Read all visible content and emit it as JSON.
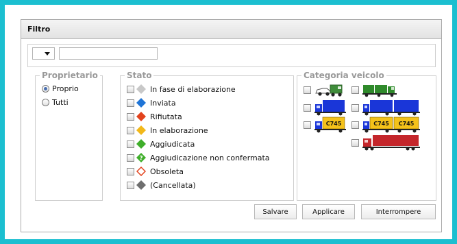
{
  "panel": {
    "title": "Filtro"
  },
  "search": {
    "dropdown_value": "",
    "text_value": ""
  },
  "owner": {
    "legend": "Proprietario",
    "options": [
      {
        "label": "Proprio",
        "checked": true
      },
      {
        "label": "Tutti",
        "checked": false
      }
    ]
  },
  "stato": {
    "legend": "Stato",
    "items": [
      {
        "label": "In fase di elaborazione",
        "icon": "gray-diamond-icon",
        "color": "#c8c8c8"
      },
      {
        "label": "Inviata",
        "icon": "blue-diamond-icon",
        "color": "#1f74d6"
      },
      {
        "label": "Rifiutata",
        "icon": "red-diamond-icon",
        "color": "#e2431d"
      },
      {
        "label": "In elaborazione",
        "icon": "yellow-diamond-icon",
        "color": "#f2b81a"
      },
      {
        "label": "Aggiudicata",
        "icon": "green-diamond-icon",
        "color": "#3fae2a"
      },
      {
        "label": "Aggiudicazione non confermata",
        "icon": "green-question-diamond-icon",
        "color": "#3fae2a"
      },
      {
        "label": "Obsoleta",
        "icon": "red-outline-diamond-icon",
        "color": "#e2431d"
      },
      {
        "label": "(Cancellata)",
        "icon": "dark-gray-diamond-icon",
        "color": "#6e6e6e"
      }
    ]
  },
  "categoria": {
    "legend": "Categoria veicolo",
    "vehicles": [
      {
        "icon": "van-car-icon"
      },
      {
        "icon": "green-truck-trailer-icon"
      },
      {
        "icon": "blue-truck-icon"
      },
      {
        "icon": "blue-truck-trailer-icon"
      },
      {
        "icon": "yellow-truck-c745-icon",
        "badge": "C745"
      },
      {
        "icon": "yellow-truck-trailer-c745-icon",
        "badge": "C745"
      },
      {
        "icon": "red-semi-truck-icon"
      }
    ]
  },
  "buttons": {
    "save": "Salvare",
    "apply": "Applicare",
    "cancel": "Interrompere"
  },
  "colors": {
    "frame": "#1cbfd0",
    "header_bg": "#e6e6e6"
  }
}
